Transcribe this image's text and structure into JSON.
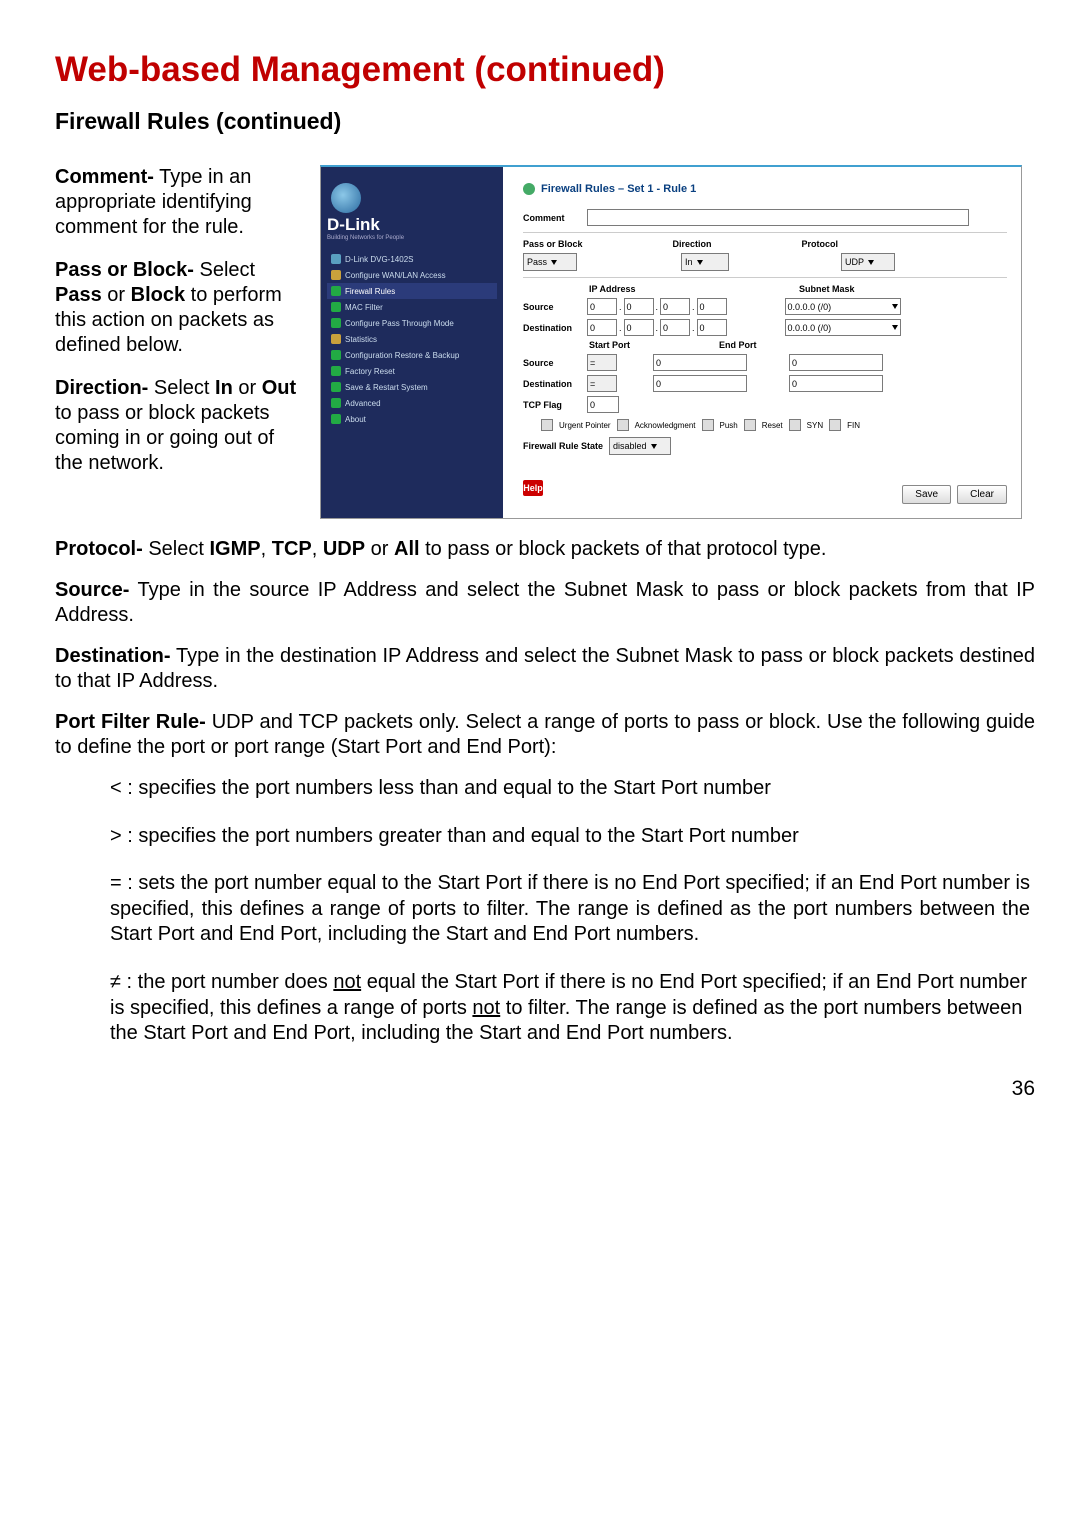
{
  "page_title": "Web-based Management (continued)",
  "subtitle": "Firewall Rules (continued)",
  "page_number": "36",
  "left": {
    "comment": {
      "label": "Comment-",
      "text": "  Type in an appropriate identifying comment for the rule."
    },
    "pass": {
      "label": "Pass or Block-",
      "text": "Select Pass or Block to perform this action on packets as defined below.",
      "b1": "Pass",
      "b2": "Block"
    },
    "direction": {
      "label": "Direction-",
      "text": " or Out to pass or block packets coming in or going out of the network.",
      "sel": "  Select ",
      "b1": "In",
      "b2": "Out"
    }
  },
  "protocol": {
    "label": "Protocol-",
    "text": " Select IGMP, TCP, UDP or All to pass or block packets of that protocol type.",
    "b1": "IGMP",
    "b2": "TCP",
    "b3": "UDP",
    "b4": "All"
  },
  "source": {
    "label": "Source-",
    "text": "  Type in the source IP Address and select the Subnet Mask to pass or block packets from that IP Address."
  },
  "destination": {
    "label": "Destination-",
    "text": "  Type in the destination IP Address and select the Subnet Mask to pass or block packets destined to that IP Address."
  },
  "portfilter": {
    "label": "Port Filter Rule-",
    "text": "  UDP and TCP packets only. Select a range of ports to pass or block. Use the following guide to define the port or port range (Start Port and End Port):"
  },
  "guide": {
    "lt": "< :  specifies the port numbers less than and equal to the Start Port number",
    "gt": "> :  specifies the port numbers greater than and equal to the Start Port number",
    "eq": "= :  sets the port number equal to the Start Port if there is no End Port specified; if an End Port number is specified, this defines a range of ports to filter. The range is defined as the port numbers between the Start Port and End Port, including the Start and End Port numbers.",
    "ne_pre": "≠ :  the port number does ",
    "ne_u1": "not",
    "ne_mid1": " equal the Start Port if there is no End Port specified; if an End Port number is specified, this defines a range of ports ",
    "ne_u2": "not",
    "ne_mid2": " to filter. The range is defined as the port numbers between the Start Port and End Port, including the Start and End Port numbers."
  },
  "shot": {
    "brand": "D-Link",
    "brand_sub": "Building Networks for People",
    "device": "D-Link DVG-1402S",
    "nav": [
      "Configure WAN/LAN Access",
      "Firewall Rules",
      "MAC Filter",
      "Configure Pass Through Mode",
      "Statistics",
      "Configuration Restore & Backup",
      "Factory Reset",
      "Save & Restart System",
      "Advanced",
      "About"
    ],
    "title": "Firewall Rules – Set 1 - Rule 1",
    "fields": {
      "comment": "Comment",
      "pass": "Pass or Block",
      "pass_val": "Pass",
      "direction": "Direction",
      "direction_val": "In",
      "protocol": "Protocol",
      "protocol_val": "UDP",
      "ip": "IP Address",
      "mask": "Subnet Mask",
      "source": "Source",
      "destination": "Destination",
      "oct": "0",
      "mask_val": "0.0.0.0 (/0)",
      "startport": "Start Port",
      "endport": "End Port",
      "portsel": "=",
      "port_val": "0",
      "tcpflag": "TCP Flag",
      "tcpflag_val": "0",
      "cb": [
        "Urgent Pointer",
        "Acknowledgment",
        "Push",
        "Reset",
        "SYN",
        "FIN"
      ],
      "state": "Firewall Rule State",
      "state_val": "disabled",
      "help": "Help",
      "save": "Save",
      "clear": "Clear"
    }
  }
}
